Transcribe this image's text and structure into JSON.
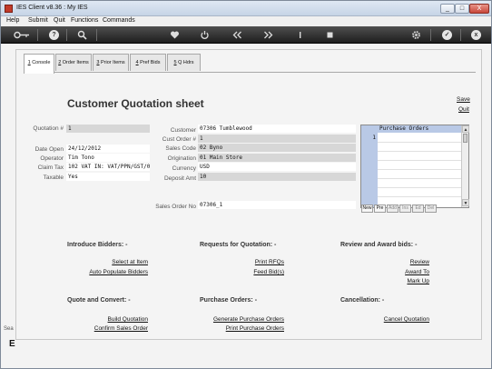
{
  "window": {
    "title": "IES Client v8.36 : My IES",
    "min_label": "_",
    "max_label": "□",
    "close_label": "X"
  },
  "menu": [
    "Help",
    "Submit",
    "Quit",
    "Functions",
    "Commands"
  ],
  "toolbar": {
    "icons": [
      "key-icon",
      "help-icon",
      "search-icon",
      "heart-icon",
      "power-icon",
      "rewind-icon",
      "fast-forward-icon",
      "stop-icon",
      "square-icon",
      "gear-icon",
      "check-icon",
      "close-icon"
    ],
    "help_label": "?",
    "check_label": "✓",
    "close_label": "x"
  },
  "tabs": [
    {
      "key": "1",
      "label": " Console"
    },
    {
      "key": "2",
      "label": " Order Items"
    },
    {
      "key": "3",
      "label": " Prior Items"
    },
    {
      "key": "4",
      "label": " Pref Bids"
    },
    {
      "key": "5",
      "label": " Q Hdrs"
    }
  ],
  "page": {
    "title": "Customer Quotation sheet",
    "save_label": "Save",
    "quit_label": "Quit"
  },
  "left_fields": {
    "quotation_label": "Quotation #",
    "quotation_value": "1",
    "date_open_label": "Date Open",
    "date_open_value": "24/12/2012",
    "operator_label": "Operator",
    "operator_value": "Tim Tono",
    "claim_tax_label": "Claim Tax",
    "claim_tax_value": "102 VAT IN: VAT/PPN/GST/0",
    "taxable_label": "Taxable",
    "taxable_value": "Yes"
  },
  "mid_fields": {
    "customer_label": "Customer",
    "customer_value": "07306 Tumblewood",
    "cust_order_label": "Cust Order #",
    "cust_order_value": "1",
    "sales_code_label": "Sales Code",
    "sales_code_value": "02 Byno",
    "origination_label": "Origination",
    "origination_value": "01 Main Store",
    "currency_label": "Currency",
    "currency_value": "USD",
    "deposit_label": "Deposit Amt",
    "deposit_value": "10",
    "sales_order_label": "Sales Order No",
    "sales_order_value": "07306_1"
  },
  "purchase_orders": {
    "header": "Purchase Orders",
    "rows": [
      "1"
    ],
    "buttons": [
      "New",
      "Pre",
      "Add",
      "Ins",
      "Ed",
      "Del"
    ],
    "scroll_up": "▲",
    "scroll_down": "▼"
  },
  "sections": {
    "introduce_bidders": {
      "title": "Introduce Bidders: -",
      "links": [
        "Select at Item",
        "Auto Populate Bidders"
      ]
    },
    "requests_for_quotation": {
      "title": "Requests for Quotation: -",
      "links": [
        "Print RFQs",
        "Feed Bid(s)"
      ]
    },
    "review_award": {
      "title": "Review and Award bids: -",
      "links": [
        "Review",
        "Award To",
        "Mark Up"
      ]
    },
    "quote_convert": {
      "title": "Quote and Convert: -",
      "links": [
        "Build Quotation",
        "Confirm Sales Order"
      ]
    },
    "purchase_orders_section": {
      "title": "Purchase Orders: -",
      "links": [
        "Generate Purchase Orders",
        "Print Purchase Orders"
      ]
    },
    "cancellation": {
      "title": "Cancellation: -",
      "links": [
        "Cancel Quotation"
      ]
    }
  },
  "left_strip": {
    "text": "Sea",
    "letter": "E"
  },
  "colors": {
    "toolbar_bg": "#2a2a2a",
    "po_highlight": "#b9c9e6",
    "field_grey": "#d7d7d7",
    "close_button": "#c8473a"
  }
}
